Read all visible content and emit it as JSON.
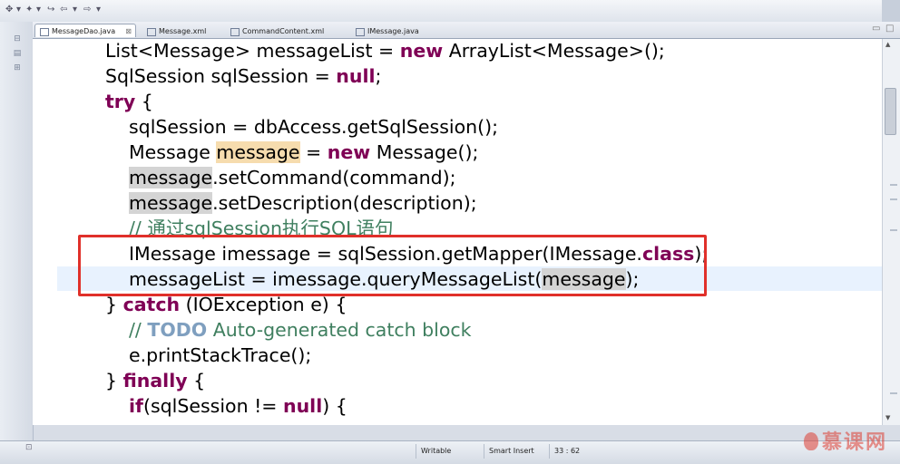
{
  "toolbar": {
    "items": [
      "✥",
      "▾",
      "✦",
      "▾",
      "↪",
      "⇦",
      "▾",
      "⇨",
      "▾"
    ]
  },
  "tabs": [
    {
      "label": "MessageDao.java",
      "active": true,
      "closable": true
    },
    {
      "label": "Message.xml",
      "active": false
    },
    {
      "label": "CommandContent.xml",
      "active": false
    },
    {
      "label": "IMessage.java",
      "active": false
    }
  ],
  "code": {
    "line1": {
      "a": "List<Message> messageList = ",
      "kw": "new",
      "b": " ArrayList<Message>();"
    },
    "line2": {
      "a": "SqlSession sqlSession = ",
      "kw": "null",
      "b": ";"
    },
    "line3": {
      "kw": "try",
      "b": " {"
    },
    "line4": {
      "a": "sqlSession = dbAccess.getSqlSession();"
    },
    "line5": {
      "a": "Message ",
      "sel": "message",
      "b": " = ",
      "kw": "new",
      "c": " Message();"
    },
    "line6": {
      "occ": "message",
      "b": ".setCommand(command);"
    },
    "line7": {
      "occ": "message",
      "b": ".setDescription(description);"
    },
    "line8": {
      "cm": "// 通过sqlSession执行SQL语句"
    },
    "line9": {
      "a": "IMessage imessage = sqlSession.getMapper(IMessage.",
      "kw": "class",
      "b": ");"
    },
    "line10": {
      "a": "messageList = imessage.queryMessageList(",
      "occ": "message",
      "b": ");"
    },
    "line11": {
      "a": "} ",
      "kw": "catch",
      "b": " (IOException e) {"
    },
    "line12": {
      "cm": "// ",
      "todo": "TODO",
      "cm2": " Auto-generated catch block"
    },
    "line13": {
      "a": "e.printStackTrace();"
    },
    "line14": {
      "a": "} ",
      "kw": "finally",
      "b": " {"
    },
    "line15": {
      "kw": "if",
      "a": "(sqlSession != ",
      "kw2": "null",
      "b": ") {"
    }
  },
  "status": {
    "writable": "Writable",
    "insert_mode": "Smart Insert",
    "position": "33 : 62"
  },
  "watermark": {
    "text": "慕课网"
  },
  "colors": {
    "keyword": "#7f0055",
    "comment": "#3f7f5f",
    "todo": "#7f9fbf",
    "highlight_box": "#e0302a",
    "current_line": "#e8f2fe"
  }
}
